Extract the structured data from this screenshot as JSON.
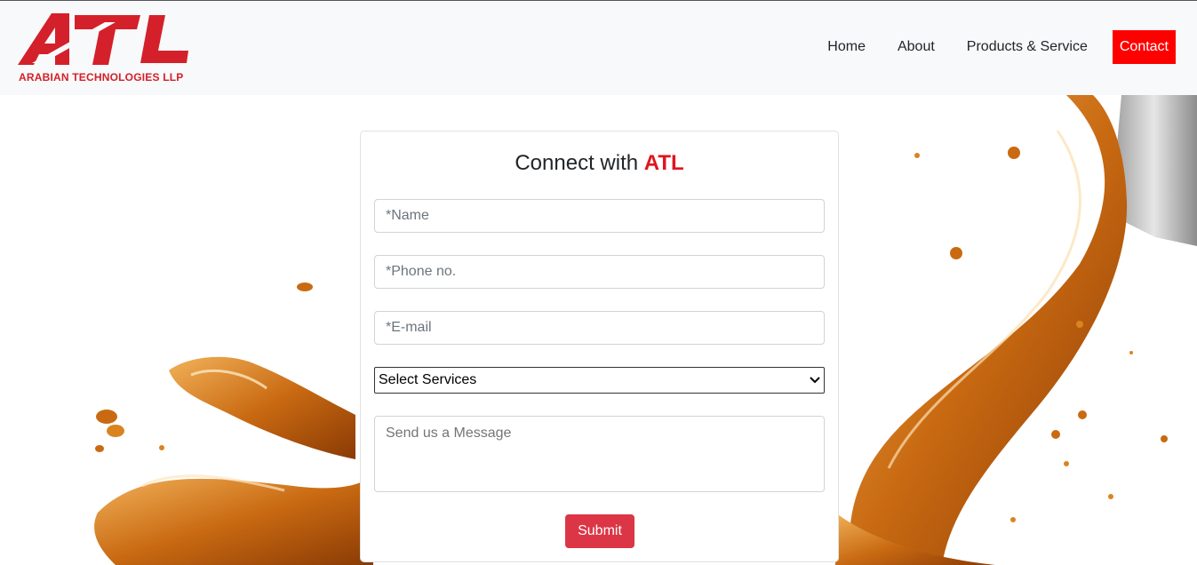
{
  "header": {
    "logo_text": "ATL",
    "logo_tagline": "ARABIAN TECHNOLOGIES LLP",
    "nav": [
      {
        "label": "Home"
      },
      {
        "label": "About"
      },
      {
        "label": "Products & Service"
      },
      {
        "label": "Contact"
      }
    ]
  },
  "form": {
    "title_prefix": "Connect with",
    "title_brand": "ATL",
    "name_placeholder": "*Name",
    "phone_placeholder": "*Phone no.",
    "email_placeholder": "*E-mail",
    "select_value": "Select Services",
    "message_placeholder": "Send us a Message",
    "submit_label": "Submit"
  },
  "colors": {
    "brand_red": "#e0141f",
    "nav_active_bg": "#ff0000",
    "submit_bg": "#dc3545",
    "oil": "#d07a1c"
  }
}
